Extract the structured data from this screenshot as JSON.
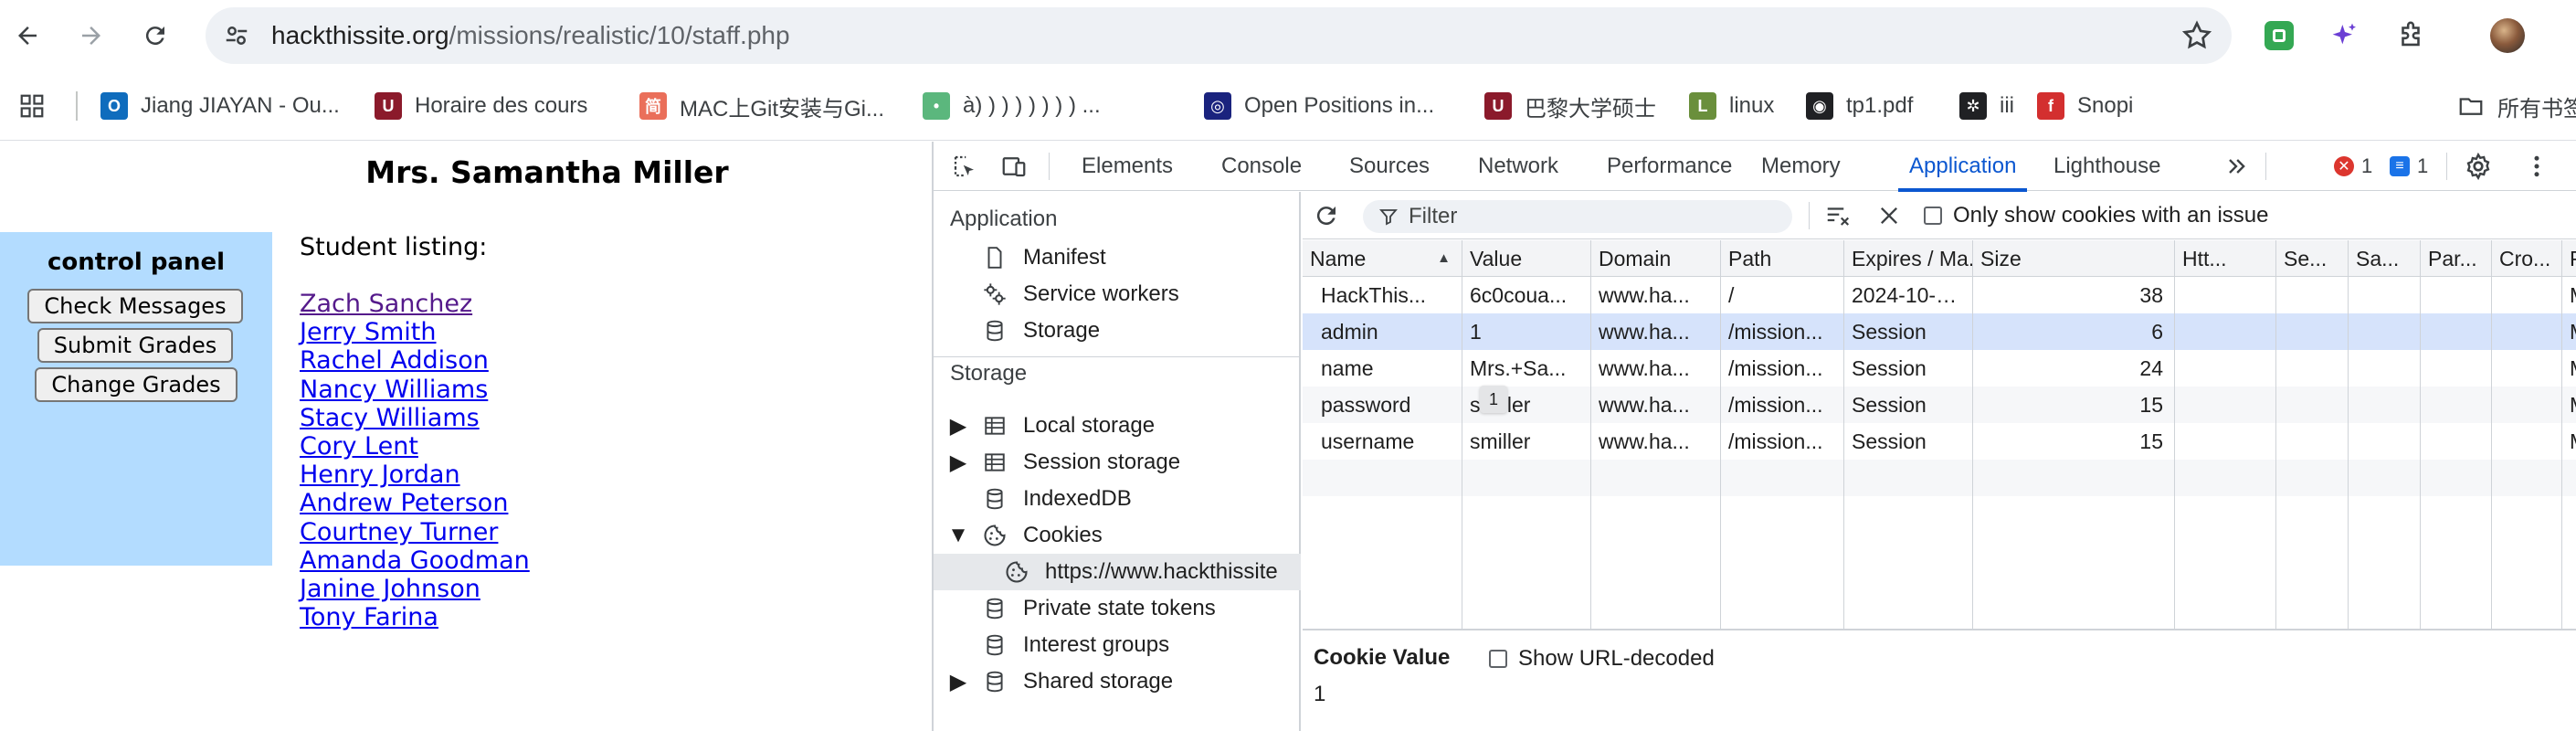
{
  "browser": {
    "url_host": "hackthissite.org",
    "url_path": "/missions/realistic/10/staff.php",
    "bookmarks": [
      {
        "label": "Jiang JIAYAN - Ou...",
        "icon": "outlook-icon",
        "color": "#0f6cbd",
        "glyph": "O"
      },
      {
        "label": "Horaire des cours",
        "icon": "university-icon",
        "color": "#8b1a2b",
        "glyph": "U"
      },
      {
        "label": "MAC上Git安装与Gi...",
        "icon": "jianshu-icon",
        "color": "#ea6f5a",
        "glyph": "简"
      },
      {
        "label": "à) ) ) ) ) ) ) ) ...",
        "icon": "bookmark-icon",
        "color": "#5bb77d",
        "glyph": "•"
      },
      {
        "label": "Open Positions in...",
        "icon": "globe-icon",
        "color": "#1a237e",
        "glyph": "◎"
      },
      {
        "label": "巴黎大学硕士",
        "icon": "university-icon",
        "color": "#8b1a2b",
        "glyph": "U"
      },
      {
        "label": "linux",
        "icon": "linux-icon",
        "color": "#6a8f3c",
        "glyph": "L"
      },
      {
        "label": "tp1.pdf",
        "icon": "globe-icon",
        "color": "#202124",
        "glyph": "◉"
      },
      {
        "label": "iii",
        "icon": "openai-icon",
        "color": "#202124",
        "glyph": "✲"
      },
      {
        "label": "Snopi",
        "icon": "snopi-icon",
        "color": "#d32f2f",
        "glyph": "f"
      }
    ],
    "all_bookmarks_label": "所有书签"
  },
  "webpage": {
    "teacher_name": "Mrs. Samantha Miller",
    "control_panel_title": "control panel",
    "buttons": [
      "Check Messages",
      "Submit Grades",
      "Change Grades"
    ],
    "listing_title": "Student listing:",
    "students": [
      {
        "name": "Zach Sanchez",
        "visited": true
      },
      {
        "name": "Jerry Smith",
        "visited": false
      },
      {
        "name": "Rachel Addison",
        "visited": false
      },
      {
        "name": "Nancy Williams",
        "visited": false
      },
      {
        "name": "Stacy Williams",
        "visited": false
      },
      {
        "name": "Cory Lent",
        "visited": false
      },
      {
        "name": "Henry Jordan",
        "visited": false
      },
      {
        "name": "Andrew Peterson",
        "visited": false
      },
      {
        "name": "Courtney Turner",
        "visited": false
      },
      {
        "name": "Amanda Goodman",
        "visited": false
      },
      {
        "name": "Janine Johnson",
        "visited": false
      },
      {
        "name": "Tony Farina",
        "visited": false
      }
    ]
  },
  "devtools": {
    "tabs": [
      "Elements",
      "Console",
      "Sources",
      "Network",
      "Performance",
      "Memory",
      "Application",
      "Lighthouse"
    ],
    "active_tab": "Application",
    "error_count": "1",
    "message_count": "1",
    "sidebar": {
      "application_header": "Application",
      "application_items": [
        "Manifest",
        "Service workers",
        "Storage"
      ],
      "storage_header": "Storage",
      "storage_items": [
        "Local storage",
        "Session storage",
        "IndexedDB",
        "Cookies"
      ],
      "cookie_origin": "https://www.hackthissite",
      "more_items": [
        "Private state tokens",
        "Interest groups",
        "Shared storage"
      ]
    },
    "cookies": {
      "filter_placeholder": "Filter",
      "only_issue_label": "Only show cookies with an issue",
      "columns": [
        "Name",
        "Value",
        "Domain",
        "Path",
        "Expires / Ma...",
        "Size",
        "Htt...",
        "Se...",
        "Sa...",
        "Par...",
        "Cro...",
        "Pri..."
      ],
      "rows": [
        {
          "name": "HackThis...",
          "value": "6c0coua...",
          "domain": "www.ha...",
          "path": "/",
          "expires": "2024-10-23...",
          "size": "38",
          "priority": "Me..."
        },
        {
          "name": "admin",
          "value": "1",
          "domain": "www.ha...",
          "path": "/mission...",
          "expires": "Session",
          "size": "6",
          "priority": "Me..."
        },
        {
          "name": "name",
          "value": "Mrs.+Sa...",
          "domain": "www.ha...",
          "path": "/mission...",
          "expires": "Session",
          "size": "24",
          "priority": "Me..."
        },
        {
          "name": "password",
          "value": "smiller",
          "domain": "www.ha...",
          "path": "/mission...",
          "expires": "Session",
          "size": "15",
          "priority": "Me..."
        },
        {
          "name": "username",
          "value": "smiller",
          "domain": "www.ha...",
          "path": "/mission...",
          "expires": "Session",
          "size": "15",
          "priority": "Me..."
        }
      ],
      "selected_row": 1,
      "tooltip": "1",
      "cookie_value_title": "Cookie Value",
      "show_url_decoded_label": "Show URL-decoded",
      "cookie_value": "1"
    }
  }
}
